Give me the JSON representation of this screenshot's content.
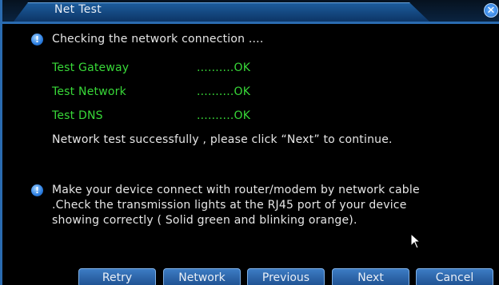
{
  "window": {
    "title": "Net Test"
  },
  "messages": {
    "checking": "Checking the network connection ....",
    "tests": [
      {
        "label": "Test Gateway",
        "result": "..........OK"
      },
      {
        "label": "Test Network",
        "result": "..........OK"
      },
      {
        "label": "Test DNS",
        "result": "..........OK"
      }
    ],
    "success": "Network test successfully , please click “Next” to continue.",
    "hint_lines": [
      "Make your device connect with router/modem by network cable",
      ".Check the transmission lights at the RJ45 port of your device",
      "showing correctly ( Solid green and blinking orange)."
    ]
  },
  "buttons": {
    "retry": "Retry",
    "network": "Network",
    "previous": "Previous",
    "next": "Next",
    "cancel": "Cancel"
  },
  "icons": {
    "info": "info-icon",
    "close": "close-icon",
    "cursor": "mouse-cursor-icon"
  },
  "colors": {
    "accent": "#2a6bb0",
    "ok_text": "#38d838",
    "background": "#000000"
  }
}
